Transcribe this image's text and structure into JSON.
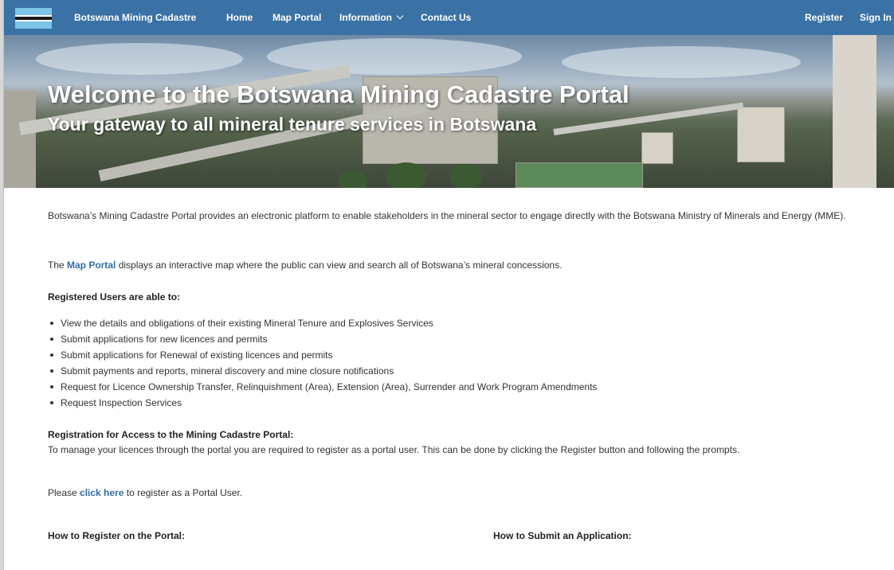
{
  "nav": {
    "brand": "Botswana Mining Cadastre",
    "home": "Home",
    "map_portal": "Map Portal",
    "information": "Information",
    "contact_us": "Contact Us",
    "register": "Register",
    "sign_in": "Sign In",
    "bg_color": "#3a72a6"
  },
  "banner": {
    "title": "Welcome to the Botswana Mining Cadastre Portal",
    "subtitle": "Your gateway to all mineral tenure services in Botswana"
  },
  "content": {
    "intro": "Botswana’s Mining Cadastre Portal provides an electronic platform to enable stakeholders in the mineral sector to engage directly with the Botswana Ministry of Minerals and Energy (MME).",
    "map_prefix": "The ",
    "map_link": "Map Portal",
    "map_suffix": " displays an interactive map where the public can view and search all of Botswana’s mineral concessions.",
    "registered_heading": "Registered Users are able to:",
    "bullets": [
      "View the details and obligations of their existing Mineral Tenure and Explosives Services",
      "Submit applications for new licences and permits",
      "Submit applications for Renewal of existing licences and permits",
      "Submit payments and reports, mineral discovery and mine closure notifications",
      "Request for Licence Ownership Transfer, Relinquishment (Area), Extension (Area), Surrender and Work Program Amendments",
      "Request Inspection Services"
    ],
    "access_heading": "Registration for Access to the Mining Cadastre Portal:",
    "access_text": "To manage your licences through the portal you are required to register as a portal user. This can be done by clicking the Register button and following the prompts.",
    "please_prefix": "Please ",
    "please_link": "click here",
    "please_suffix": " to register as a Portal User.",
    "how_register": "How to Register on the Portal:",
    "how_submit": "How to Submit an Application:",
    "link_color": "#2f6ea7"
  }
}
